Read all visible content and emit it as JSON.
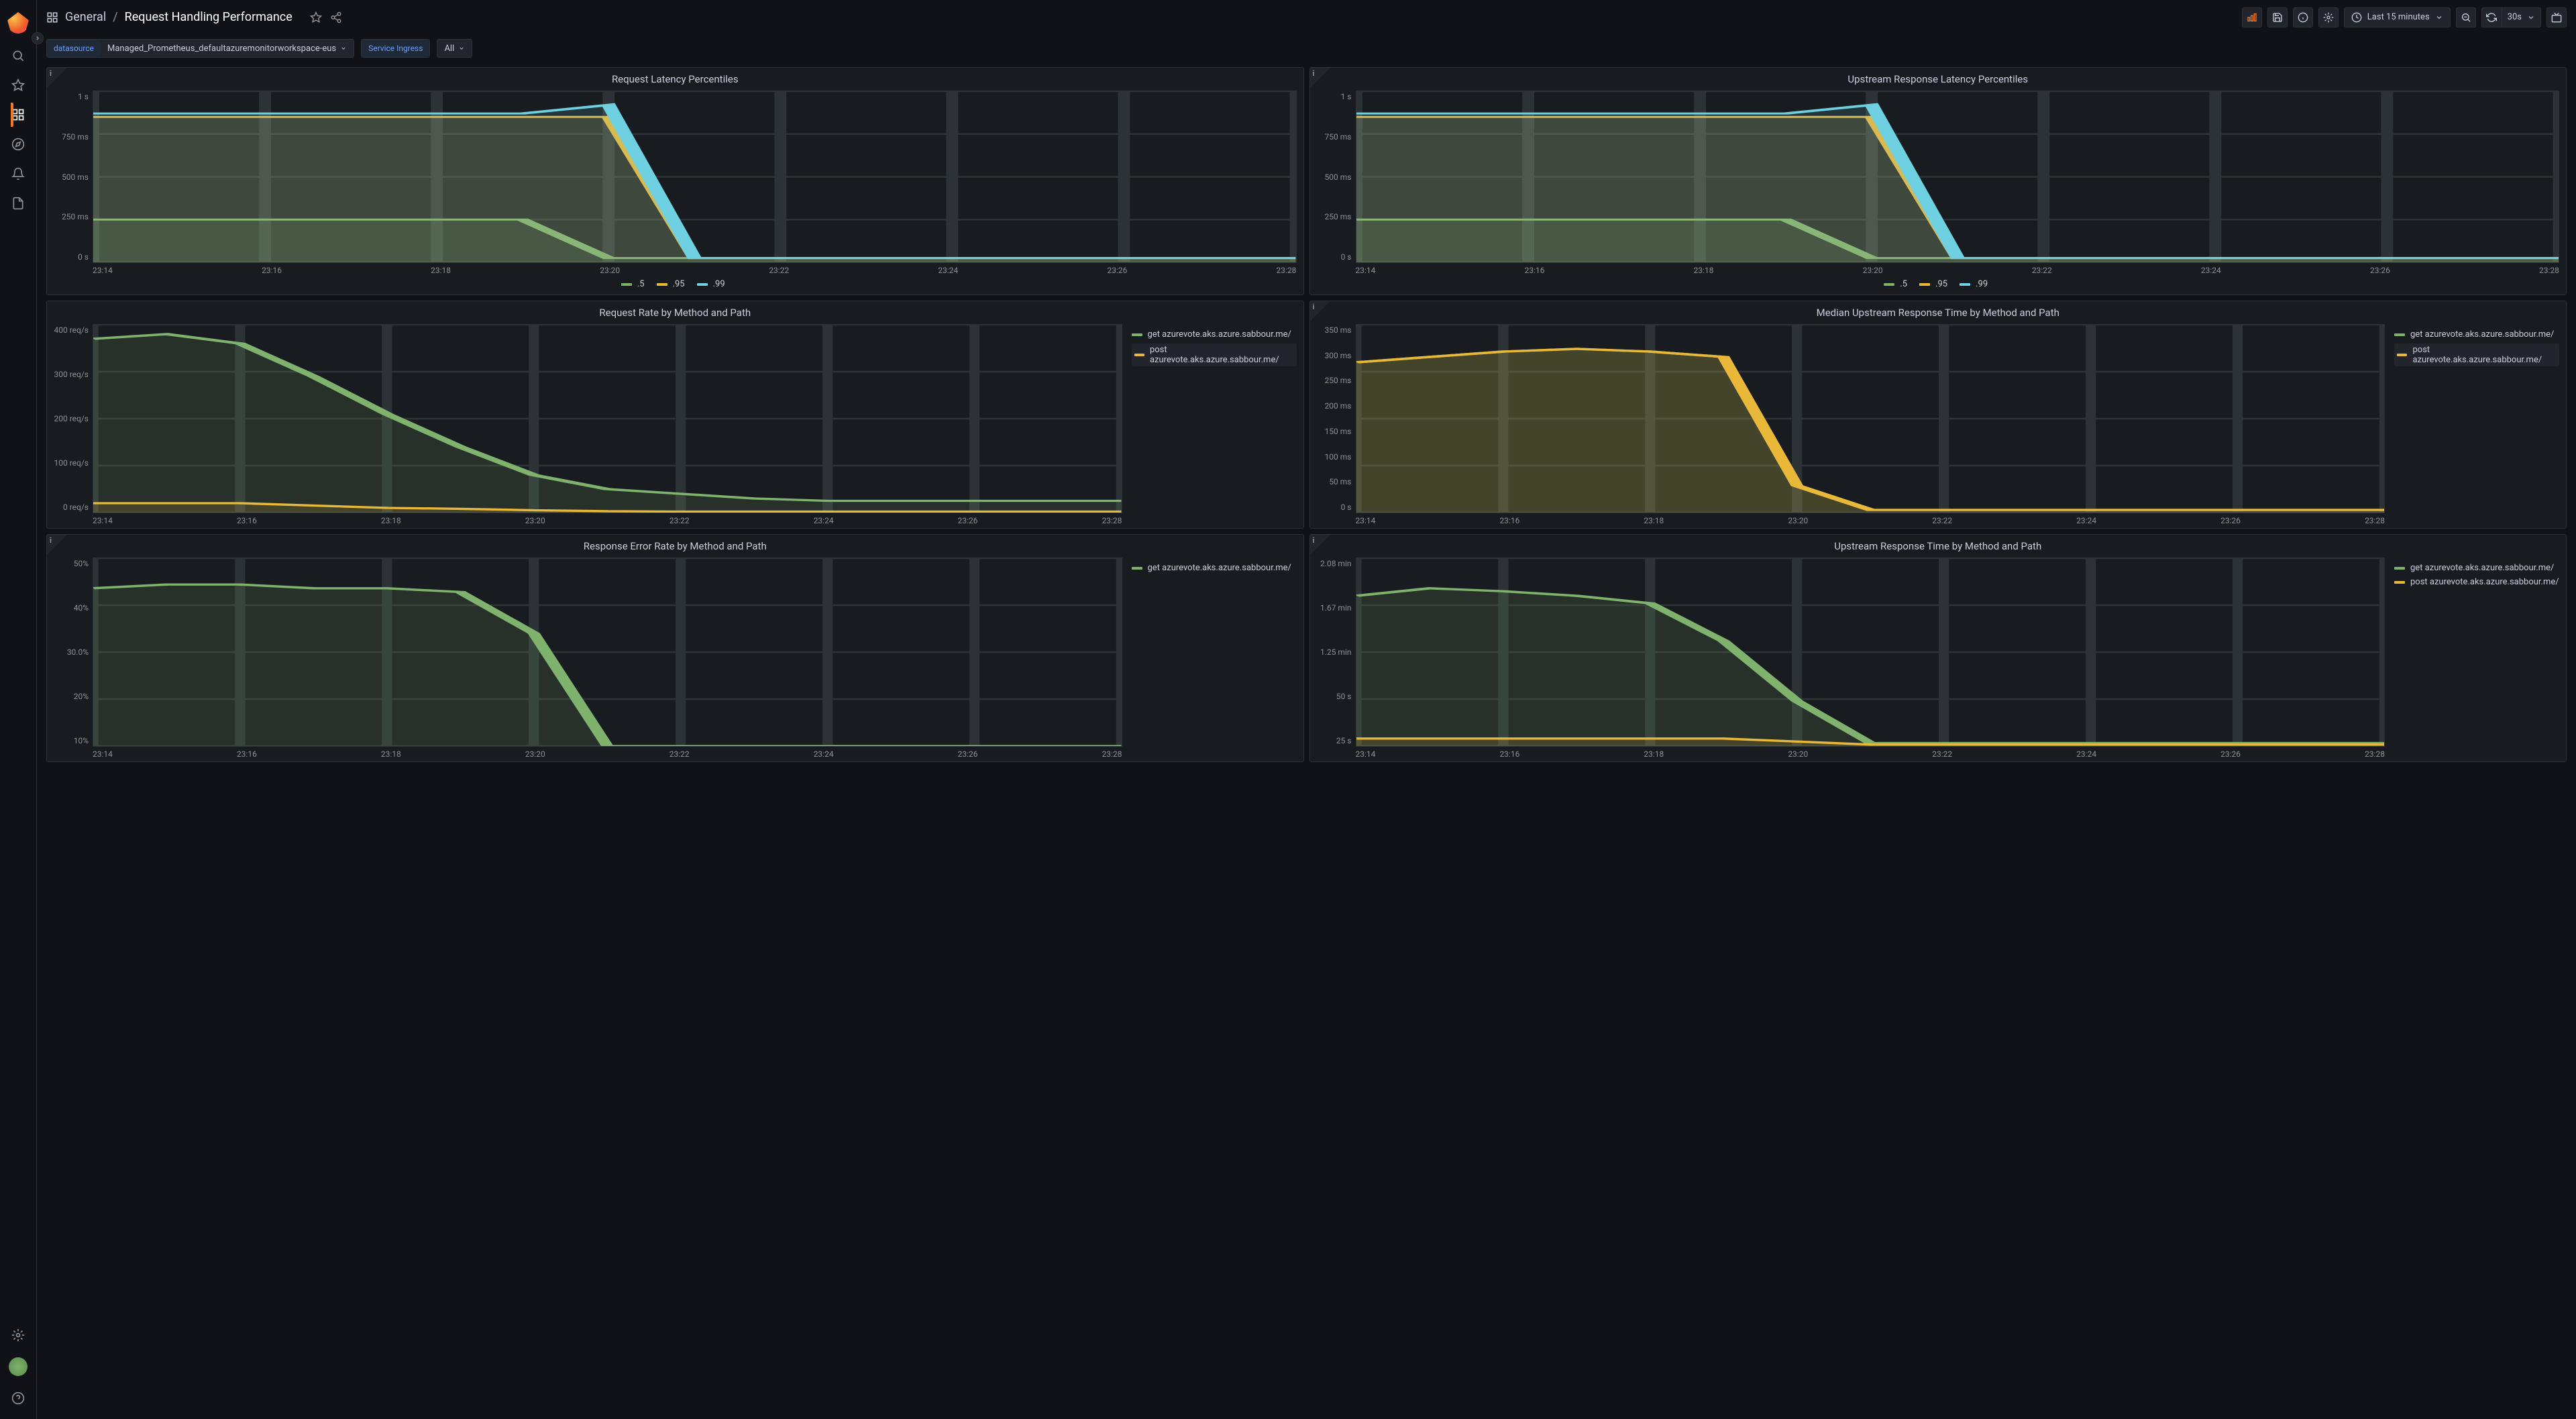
{
  "breadcrumb": {
    "folder": "General",
    "title": "Request Handling Performance"
  },
  "toolbar": {
    "time_range": "Last 15 minutes",
    "refresh_interval": "30s"
  },
  "vars": {
    "datasource_label": "datasource",
    "datasource_value": "Managed_Prometheus_defaultazuremonitorworkspace-eus",
    "service_label": "Service Ingress",
    "service_value": "All"
  },
  "time_ticks": [
    "23:14",
    "23:16",
    "23:18",
    "23:20",
    "23:22",
    "23:24",
    "23:26",
    "23:28"
  ],
  "colors": {
    "green": "#7eb26d",
    "yellow": "#eab839",
    "blue": "#6ed0e0"
  },
  "panels": [
    {
      "id": "req-latency",
      "title": "Request Latency Percentiles",
      "y_ticks": [
        "1 s",
        "750 ms",
        "500 ms",
        "250 ms",
        "0 s"
      ],
      "legend_pos": "bottom",
      "legend": [
        {
          "label": ".5",
          "color": "green"
        },
        {
          "label": ".95",
          "color": "yellow"
        },
        {
          "label": ".99",
          "color": "blue"
        }
      ]
    },
    {
      "id": "upstream-latency",
      "title": "Upstream Response Latency Percentiles",
      "y_ticks": [
        "1 s",
        "750 ms",
        "500 ms",
        "250 ms",
        "0 s"
      ],
      "legend_pos": "bottom",
      "legend": [
        {
          "label": ".5",
          "color": "green"
        },
        {
          "label": ".95",
          "color": "yellow"
        },
        {
          "label": ".99",
          "color": "blue"
        }
      ]
    },
    {
      "id": "req-rate",
      "title": "Request Rate by Method and Path",
      "y_ticks": [
        "400 req/s",
        "300 req/s",
        "200 req/s",
        "100 req/s",
        "0 req/s"
      ],
      "legend_pos": "side",
      "legend": [
        {
          "label": "get azurevote.aks.azure.sabbour.me/",
          "color": "green"
        },
        {
          "label": "post azurevote.aks.azure.sabbour.me/",
          "color": "yellow",
          "sel": true
        }
      ]
    },
    {
      "id": "median-upstream",
      "title": "Median Upstream Response Time by Method and Path",
      "y_ticks": [
        "350 ms",
        "300 ms",
        "250 ms",
        "200 ms",
        "150 ms",
        "100 ms",
        "50 ms",
        "0 s"
      ],
      "legend_pos": "side",
      "legend": [
        {
          "label": "get azurevote.aks.azure.sabbour.me/",
          "color": "green"
        },
        {
          "label": "post azurevote.aks.azure.sabbour.me/",
          "color": "yellow",
          "sel": true
        }
      ]
    },
    {
      "id": "error-rate",
      "title": "Response Error Rate by Method and Path",
      "y_ticks": [
        "50%",
        "40%",
        "30.0%",
        "20%",
        "10%"
      ],
      "legend_pos": "side",
      "legend": [
        {
          "label": "get azurevote.aks.azure.sabbour.me/",
          "color": "green"
        }
      ]
    },
    {
      "id": "upstream-time",
      "title": "Upstream Response Time by Method and Path",
      "y_ticks": [
        "2.08 min",
        "1.67 min",
        "1.25 min",
        "50 s",
        "25 s"
      ],
      "legend_pos": "side",
      "legend": [
        {
          "label": "get azurevote.aks.azure.sabbour.me/",
          "color": "green"
        },
        {
          "label": "post azurevote.aks.azure.sabbour.me/",
          "color": "yellow"
        }
      ]
    }
  ],
  "chart_data": [
    {
      "id": "req-latency",
      "type": "area",
      "x": [
        "23:14",
        "23:15",
        "23:16",
        "23:17",
        "23:18",
        "23:19",
        "23:20",
        "23:21",
        "23:22",
        "23:23",
        "23:24",
        "23:25",
        "23:26",
        "23:27",
        "23:28"
      ],
      "series": [
        {
          "name": ".5",
          "values": [
            250,
            250,
            250,
            250,
            250,
            250,
            25,
            25,
            25,
            25,
            25,
            25,
            25,
            25,
            25
          ]
        },
        {
          "name": ".95",
          "values": [
            850,
            850,
            850,
            850,
            850,
            850,
            850,
            25,
            25,
            25,
            25,
            25,
            25,
            25,
            25
          ]
        },
        {
          "name": ".99",
          "values": [
            870,
            870,
            870,
            870,
            870,
            870,
            920,
            25,
            25,
            25,
            25,
            25,
            25,
            25,
            25
          ]
        }
      ],
      "ylim": [
        0,
        1000
      ],
      "yunit": "ms"
    },
    {
      "id": "upstream-latency",
      "type": "area",
      "x": [
        "23:14",
        "23:15",
        "23:16",
        "23:17",
        "23:18",
        "23:19",
        "23:20",
        "23:21",
        "23:22",
        "23:23",
        "23:24",
        "23:25",
        "23:26",
        "23:27",
        "23:28"
      ],
      "series": [
        {
          "name": ".5",
          "values": [
            250,
            250,
            250,
            250,
            250,
            250,
            25,
            25,
            25,
            25,
            25,
            25,
            25,
            25,
            25
          ]
        },
        {
          "name": ".95",
          "values": [
            850,
            850,
            850,
            850,
            850,
            850,
            850,
            25,
            25,
            25,
            25,
            25,
            25,
            25,
            25
          ]
        },
        {
          "name": ".99",
          "values": [
            870,
            870,
            870,
            870,
            870,
            870,
            920,
            25,
            25,
            25,
            25,
            25,
            25,
            25,
            25
          ]
        }
      ],
      "ylim": [
        0,
        1000
      ],
      "yunit": "ms"
    },
    {
      "id": "req-rate",
      "type": "area",
      "x": [
        "23:14",
        "23:15",
        "23:16",
        "23:17",
        "23:18",
        "23:19",
        "23:20",
        "23:21",
        "23:22",
        "23:23",
        "23:24",
        "23:25",
        "23:26",
        "23:27",
        "23:28"
      ],
      "series": [
        {
          "name": "get azurevote.aks.azure.sabbour.me/",
          "values": [
            370,
            380,
            360,
            290,
            210,
            140,
            80,
            50,
            40,
            30,
            25,
            25,
            25,
            25,
            25
          ]
        },
        {
          "name": "post azurevote.aks.azure.sabbour.me/",
          "values": [
            20,
            20,
            20,
            15,
            10,
            8,
            5,
            3,
            2,
            2,
            2,
            2,
            2,
            2,
            2
          ]
        }
      ],
      "ylim": [
        0,
        400
      ],
      "yunit": "req/s"
    },
    {
      "id": "median-upstream",
      "type": "area",
      "x": [
        "23:14",
        "23:15",
        "23:16",
        "23:17",
        "23:18",
        "23:19",
        "23:20",
        "23:21",
        "23:22",
        "23:23",
        "23:24",
        "23:25",
        "23:26",
        "23:27",
        "23:28"
      ],
      "series": [
        {
          "name": "get azurevote.aks.azure.sabbour.me/",
          "values": [
            280,
            290,
            300,
            305,
            300,
            290,
            50,
            5,
            5,
            5,
            5,
            5,
            5,
            5,
            5
          ]
        },
        {
          "name": "post azurevote.aks.azure.sabbour.me/",
          "values": [
            280,
            290,
            300,
            305,
            300,
            290,
            50,
            5,
            5,
            5,
            5,
            5,
            5,
            5,
            5
          ]
        }
      ],
      "ylim": [
        0,
        350
      ],
      "yunit": "ms"
    },
    {
      "id": "error-rate",
      "type": "area",
      "x": [
        "23:14",
        "23:15",
        "23:16",
        "23:17",
        "23:18",
        "23:19",
        "23:20",
        "23:21",
        "23:22",
        "23:23",
        "23:24",
        "23:25",
        "23:26",
        "23:27",
        "23:28"
      ],
      "series": [
        {
          "name": "get azurevote.aks.azure.sabbour.me/",
          "values": [
            42,
            43,
            43,
            42,
            42,
            41,
            30,
            0,
            0,
            0,
            0,
            0,
            0,
            0,
            0
          ]
        }
      ],
      "ylim": [
        0,
        50
      ],
      "yunit": "%"
    },
    {
      "id": "upstream-time",
      "type": "area",
      "x": [
        "23:14",
        "23:15",
        "23:16",
        "23:17",
        "23:18",
        "23:19",
        "23:20",
        "23:21",
        "23:22",
        "23:23",
        "23:24",
        "23:25",
        "23:26",
        "23:27",
        "23:28"
      ],
      "series": [
        {
          "name": "get azurevote.aks.azure.sabbour.me/",
          "values": [
            100,
            105,
            103,
            100,
            95,
            70,
            30,
            2,
            2,
            2,
            2,
            2,
            2,
            2,
            2
          ]
        },
        {
          "name": "post azurevote.aks.azure.sabbour.me/",
          "values": [
            5,
            5,
            5,
            5,
            5,
            5,
            3,
            1,
            1,
            1,
            1,
            1,
            1,
            1,
            1
          ]
        }
      ],
      "ylim": [
        0,
        125
      ],
      "yunit": "s"
    }
  ]
}
